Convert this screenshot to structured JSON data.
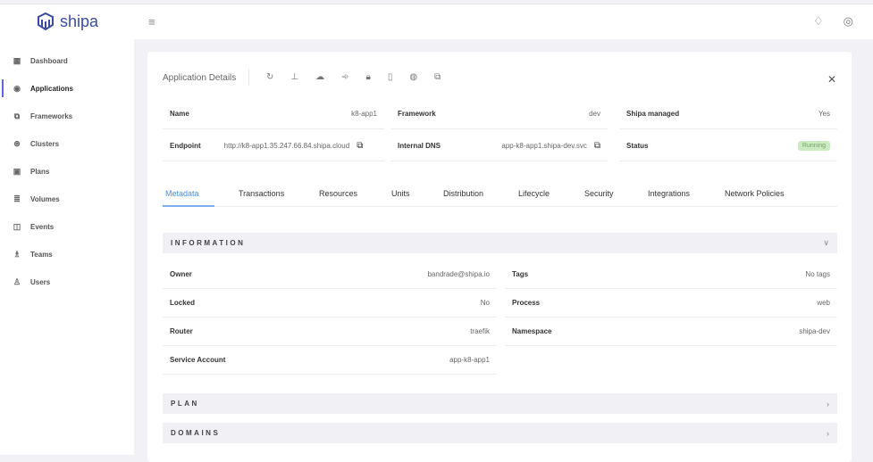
{
  "brand": "shipa",
  "sidebar": {
    "items": [
      {
        "label": "Dashboard",
        "icon": "dashboard-icon",
        "glyph": "▦"
      },
      {
        "label": "Applications",
        "icon": "applications-icon",
        "glyph": "◉"
      },
      {
        "label": "Frameworks",
        "icon": "frameworks-icon",
        "glyph": "⧉"
      },
      {
        "label": "Clusters",
        "icon": "clusters-icon",
        "glyph": "⊛"
      },
      {
        "label": "Plans",
        "icon": "plans-icon",
        "glyph": "▣"
      },
      {
        "label": "Volumes",
        "icon": "volumes-icon",
        "glyph": "≣"
      },
      {
        "label": "Events",
        "icon": "events-icon",
        "glyph": "◫"
      },
      {
        "label": "Teams",
        "icon": "teams-icon",
        "glyph": "♗"
      },
      {
        "label": "Users",
        "icon": "users-icon",
        "glyph": "♙"
      }
    ]
  },
  "card": {
    "title": "Application Details",
    "summary": [
      {
        "key": "Name",
        "value": "k8-app1"
      },
      {
        "key": "Framework",
        "value": "dev"
      },
      {
        "key": "Shipa managed",
        "value": "Yes"
      },
      {
        "key": "Endpoint",
        "value": "http://k8-app1.35.247.66.84.shipa.cloud"
      },
      {
        "key": "Internal DNS",
        "value": "app-k8-app1.shipa-dev.svc"
      },
      {
        "key": "Status",
        "value": "Running"
      }
    ],
    "tabs": [
      "Metadata",
      "Transactions",
      "Resources",
      "Units",
      "Distribution",
      "Lifecycle",
      "Security",
      "Integrations",
      "Network Policies"
    ],
    "active_tab": "Metadata",
    "sections": {
      "information": "INFORMATION",
      "plan": "PLAN",
      "domains": "DOMAINS"
    },
    "info_left": [
      {
        "key": "Owner",
        "value": "bandrade@shipa.io"
      },
      {
        "key": "Locked",
        "value": "No"
      },
      {
        "key": "Router",
        "value": "traefik"
      },
      {
        "key": "Service Account",
        "value": "app-k8-app1"
      }
    ],
    "info_right": [
      {
        "key": "Tags",
        "value": "No tags"
      },
      {
        "key": "Process",
        "value": "web"
      },
      {
        "key": "Namespace",
        "value": "shipa-dev"
      }
    ]
  },
  "colors": {
    "accent": "#5b6ad8",
    "tab_active": "#4a8ee0",
    "running_bg": "#cdebc3"
  }
}
